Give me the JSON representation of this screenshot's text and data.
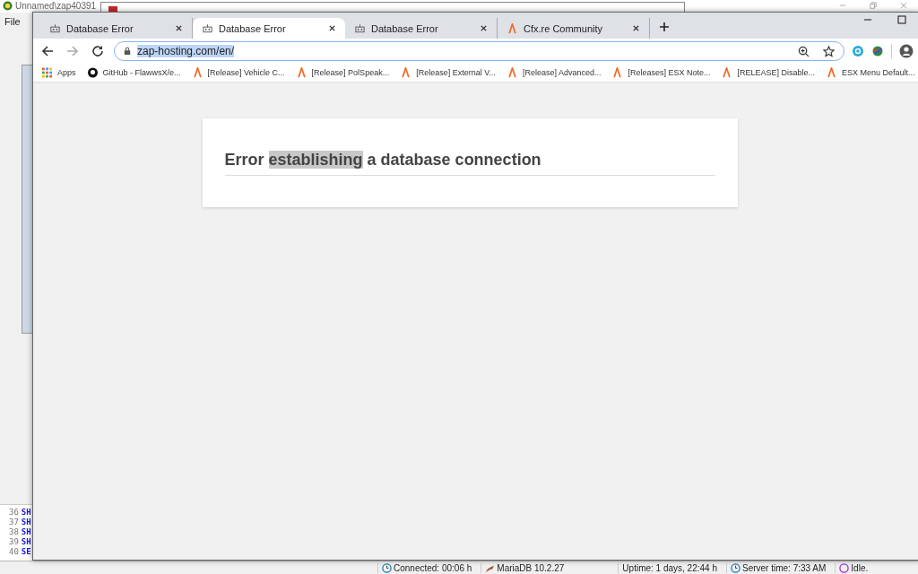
{
  "background_app": {
    "title": "Unnamed\\zap40391",
    "menu": [
      "File"
    ],
    "sql_lines": [
      {
        "number": "36",
        "code": "SH"
      },
      {
        "number": "37",
        "code": "SH"
      },
      {
        "number": "38",
        "code": "SH"
      },
      {
        "number": "39",
        "code": "SH"
      },
      {
        "number": "40",
        "code": "SE"
      }
    ],
    "status_bar": [
      {
        "kind": "clock",
        "text": "Connected: 00:06 h"
      },
      {
        "kind": "db",
        "text": "MariaDB 10.2.27"
      },
      {
        "kind": "plain",
        "text": "Uptime: 1 days, 22:44 h"
      },
      {
        "kind": "clock",
        "text": "Server time: 7:33 AM"
      },
      {
        "kind": "idle",
        "text": "Idle."
      }
    ]
  },
  "browser": {
    "tabs": [
      {
        "title": "Database Error",
        "kind": "robot",
        "selected": false
      },
      {
        "title": "Database Error",
        "kind": "robot",
        "selected": true
      },
      {
        "title": "Database Error",
        "kind": "robot",
        "selected": false
      },
      {
        "title": "Cfx.re Community",
        "kind": "chevron",
        "selected": false
      }
    ],
    "address": {
      "url": "zap-hosting.com/en/",
      "selected": true
    },
    "bookmarks": [
      {
        "label": "Apps",
        "kind": "grid"
      },
      {
        "label": "GitHub - FlawwsX/e...",
        "kind": "octocat"
      },
      {
        "label": "[Release] Vehicle C...",
        "kind": "chevron"
      },
      {
        "label": "[Release] PolSpeak...",
        "kind": "chevron"
      },
      {
        "label": "[Release] External V...",
        "kind": "chevron"
      },
      {
        "label": "[Release] Advanced...",
        "kind": "chevron"
      },
      {
        "label": "[Releases] ESX Note...",
        "kind": "chevron"
      },
      {
        "label": "[RELEASE] Disable...",
        "kind": "chevron"
      },
      {
        "label": "ESX Menu Default...",
        "kind": "chevron"
      }
    ],
    "page": {
      "heading": [
        {
          "text": "Error ",
          "selected": false
        },
        {
          "text": "establishing",
          "selected": true
        },
        {
          "text": " a database connection",
          "selected": false
        }
      ]
    }
  }
}
